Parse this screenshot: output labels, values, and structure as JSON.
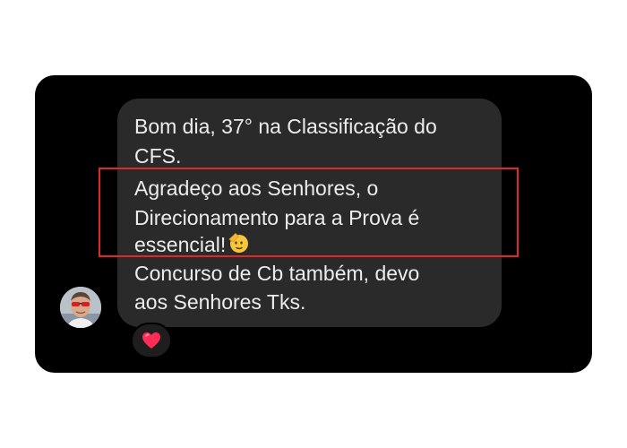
{
  "message": {
    "lines": [
      "Bom dia, 37° na Classificação do",
      "CFS.",
      "Agradeço aos Senhores, o",
      "Direcionamento para a Prova é",
      "essencial!",
      "Concurso de Cb também, devo",
      "aos Senhores Tks."
    ],
    "inline_emoji": "saluting-face-icon"
  },
  "reaction": {
    "icon": "heart-icon",
    "color": "#ff2d55"
  },
  "avatar": {
    "icon": "user-avatar"
  },
  "highlight": {
    "color": "#e02828"
  },
  "theme": {
    "screen_background": "#000000",
    "bubble_background": "#2a2a2a",
    "text_color": "#ececec"
  }
}
